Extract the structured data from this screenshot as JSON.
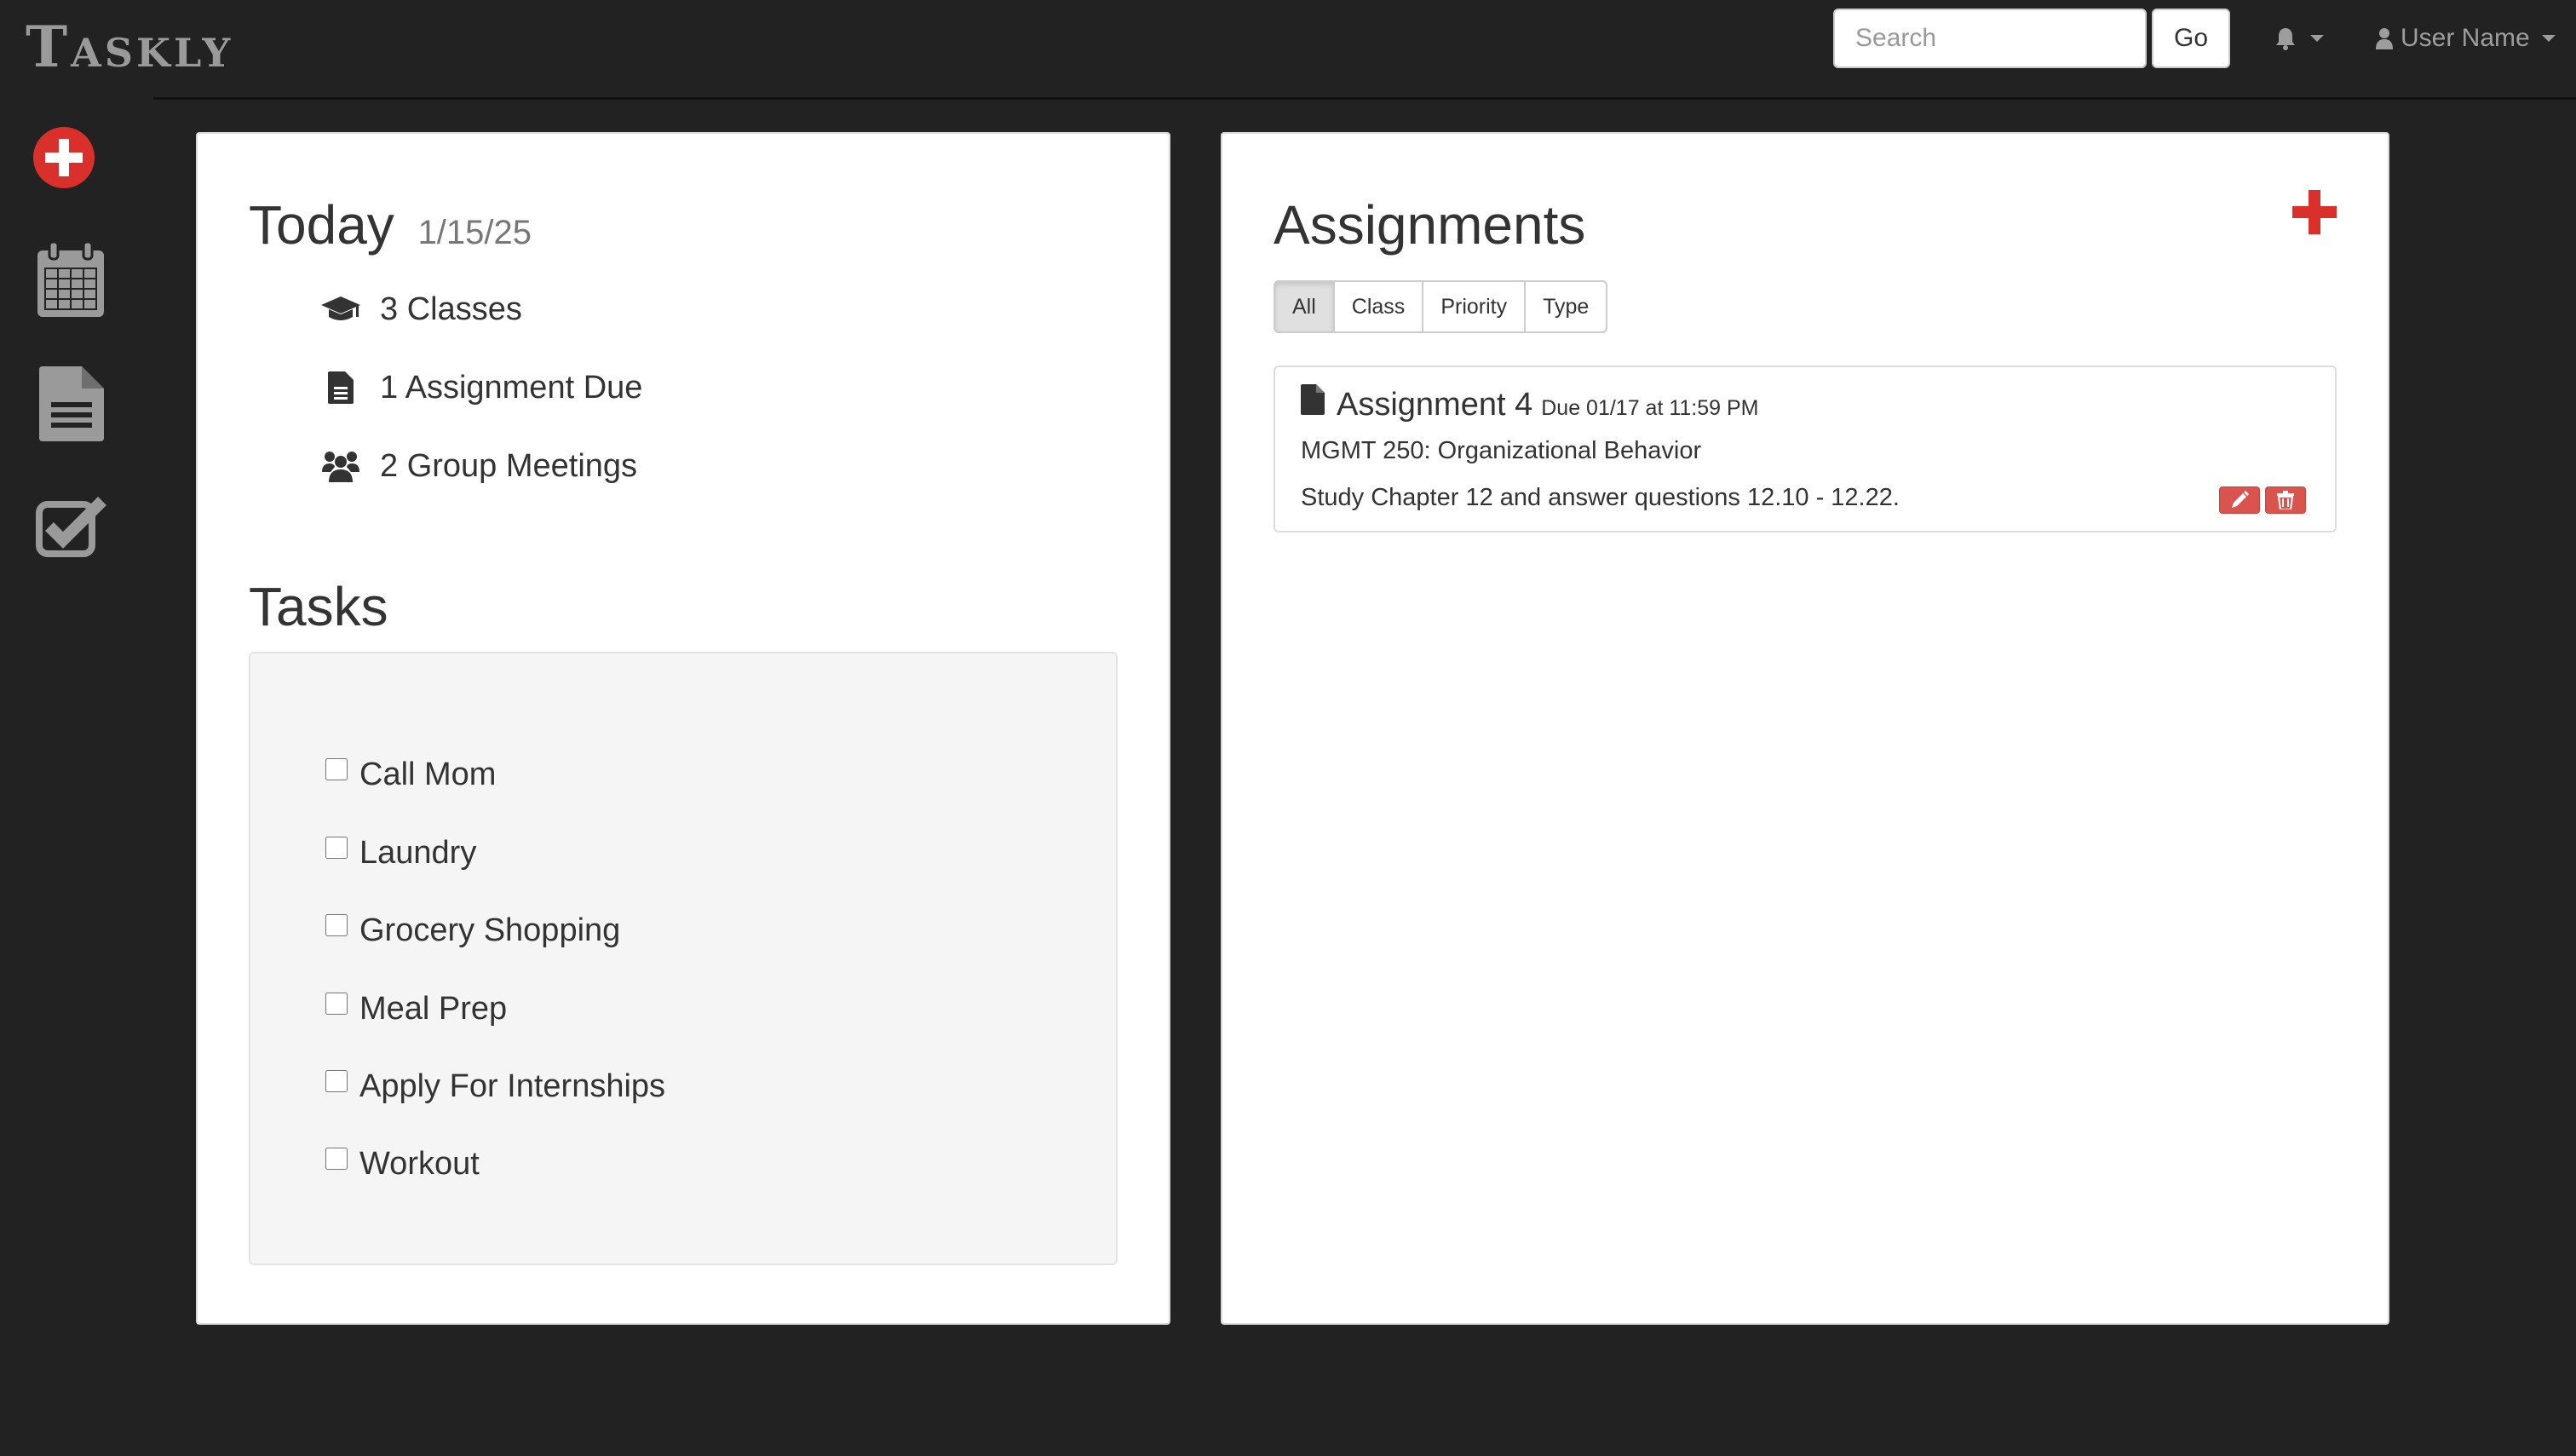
{
  "app": {
    "name": "Taskly"
  },
  "header": {
    "search": {
      "placeholder": "Search",
      "value": ""
    },
    "go_label": "Go",
    "notifications_icon": "bell-icon",
    "user_name": "User Name"
  },
  "sidebar": {
    "items": [
      {
        "icon": "plus-circle-icon",
        "color": "#d9302c"
      },
      {
        "icon": "calendar-icon",
        "color": "#9a9a9a"
      },
      {
        "icon": "document-icon",
        "color": "#9a9a9a"
      },
      {
        "icon": "checkbox-icon",
        "color": "#9a9a9a"
      }
    ]
  },
  "today": {
    "title": "Today",
    "date": "1/15/25",
    "summary": [
      {
        "icon": "graduation-cap-icon",
        "text": "3 Classes"
      },
      {
        "icon": "file-icon",
        "text": "1 Assignment Due"
      },
      {
        "icon": "users-icon",
        "text": "2 Group Meetings"
      }
    ]
  },
  "tasks": {
    "title": "Tasks",
    "items": [
      {
        "label": "Call Mom",
        "checked": false
      },
      {
        "label": "Laundry",
        "checked": false
      },
      {
        "label": "Grocery Shopping",
        "checked": false
      },
      {
        "label": "Meal Prep",
        "checked": false
      },
      {
        "label": "Apply For Internships",
        "checked": false
      },
      {
        "label": "Workout",
        "checked": false
      }
    ]
  },
  "assignments": {
    "title": "Assignments",
    "filters": [
      "All",
      "Class",
      "Priority",
      "Type"
    ],
    "active_filter": "All",
    "items": [
      {
        "title": "Assignment 4",
        "due": "Due 01/17 at 11:59 PM",
        "class": "MGMT 250: Organizational Behavior",
        "description": "Study Chapter 12 and answer questions 12.10 - 12.22."
      }
    ]
  },
  "colors": {
    "accent": "#d9302c",
    "background": "#222222",
    "danger": "#d9534f"
  }
}
